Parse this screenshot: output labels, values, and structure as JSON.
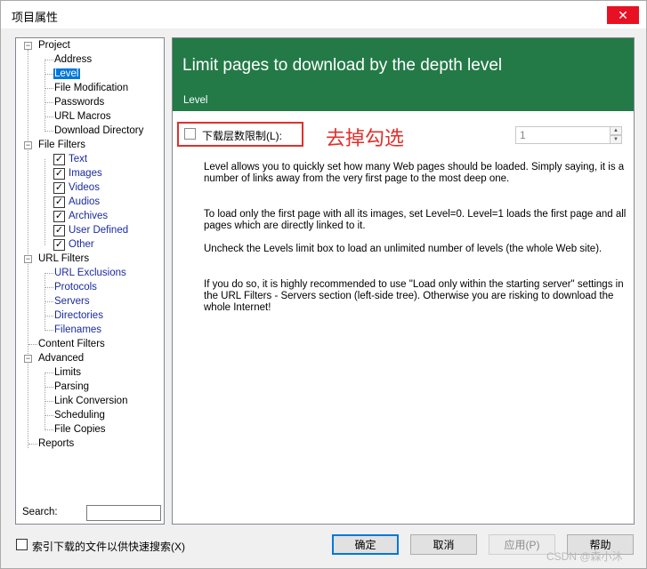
{
  "window": {
    "title": "项目属性",
    "close_glyph": "✕"
  },
  "tree": {
    "items": [
      {
        "label": "Project"
      },
      {
        "label": "Address"
      },
      {
        "label": "Level"
      },
      {
        "label": "File Modification"
      },
      {
        "label": "Passwords"
      },
      {
        "label": "URL Macros"
      },
      {
        "label": "Download Directory"
      },
      {
        "label": "File Filters"
      },
      {
        "label": "Text"
      },
      {
        "label": "Images"
      },
      {
        "label": "Videos"
      },
      {
        "label": "Audios"
      },
      {
        "label": "Archives"
      },
      {
        "label": "User Defined"
      },
      {
        "label": "Other"
      },
      {
        "label": "URL Filters"
      },
      {
        "label": "URL Exclusions"
      },
      {
        "label": "Protocols"
      },
      {
        "label": "Servers"
      },
      {
        "label": "Directories"
      },
      {
        "label": "Filenames"
      },
      {
        "label": "Content Filters"
      },
      {
        "label": "Advanced"
      },
      {
        "label": "Limits"
      },
      {
        "label": "Parsing"
      },
      {
        "label": "Link Conversion"
      },
      {
        "label": "Scheduling"
      },
      {
        "label": "File Copies"
      },
      {
        "label": "Reports"
      }
    ],
    "selected": "Level",
    "check_glyph": "✓",
    "collapse_glyph": "−",
    "search_label": "Search:",
    "search_value": ""
  },
  "content": {
    "banner_title": "Limit pages to download by the depth level",
    "banner_subtitle": "Level",
    "level_check_label": "下载层数限制(L):",
    "level_checked": false,
    "annotation": "去掉勾选",
    "level_value": "1",
    "spin_up_glyph": "▲",
    "spin_down_glyph": "▼",
    "paragraphs": [
      "Level allows you to quickly set how many Web pages should be loaded. Simply saying, it is a number of links away from the very first page to the most deep one.",
      "To load only the first page with all its images, set Level=0. Level=1 loads the first page and all pages which are directly linked to it.",
      "Uncheck the Levels limit box to load an unlimited number of levels (the whole Web site).",
      "If you do so, it is highly recommended to use \"Load only within the starting server\" settings in the URL Filters - Servers section (left-side tree). Otherwise you are risking to download the whole Internet!"
    ]
  },
  "footer": {
    "index_check_label": "索引下载的文件以供快速搜索(X)",
    "index_checked": false,
    "ok_label": "确定",
    "cancel_label": "取消",
    "apply_label": "应用(P)",
    "help_label": "帮助"
  },
  "watermark": "CSDN @森小沐",
  "colors": {
    "banner": "#237a47",
    "accent": "#0078d7",
    "annotation": "#e0302c"
  }
}
